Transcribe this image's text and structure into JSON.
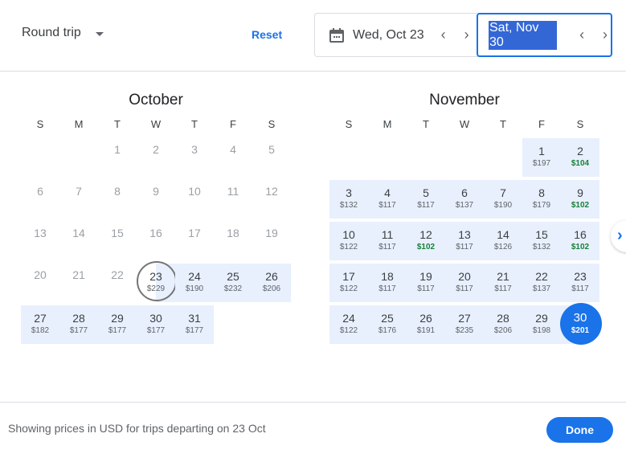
{
  "header": {
    "trip_type": "Round trip",
    "reset_label": "Reset",
    "departure_date": "Wed, Oct 23",
    "return_date": "Sat, Nov 30",
    "prev_glyph": "‹",
    "next_glyph": "›",
    "calendar_icon": "calendar-icon"
  },
  "weekdays": [
    "S",
    "M",
    "T",
    "W",
    "T",
    "F",
    "S"
  ],
  "months": [
    {
      "title": "October",
      "leading_blanks": 2,
      "days": [
        {
          "d": "1",
          "state": "past"
        },
        {
          "d": "2",
          "state": "past"
        },
        {
          "d": "3",
          "state": "past"
        },
        {
          "d": "4",
          "state": "past"
        },
        {
          "d": "5",
          "state": "past"
        },
        {
          "d": "6",
          "state": "past"
        },
        {
          "d": "7",
          "state": "past"
        },
        {
          "d": "8",
          "state": "past"
        },
        {
          "d": "9",
          "state": "past"
        },
        {
          "d": "10",
          "state": "past"
        },
        {
          "d": "11",
          "state": "past"
        },
        {
          "d": "12",
          "state": "past"
        },
        {
          "d": "13",
          "state": "past"
        },
        {
          "d": "14",
          "state": "past"
        },
        {
          "d": "15",
          "state": "past"
        },
        {
          "d": "16",
          "state": "past"
        },
        {
          "d": "17",
          "state": "past"
        },
        {
          "d": "18",
          "state": "past"
        },
        {
          "d": "19",
          "state": "past"
        },
        {
          "d": "20",
          "state": "past"
        },
        {
          "d": "21",
          "state": "past"
        },
        {
          "d": "22",
          "state": "past"
        },
        {
          "d": "23",
          "price": "$229",
          "state": "start"
        },
        {
          "d": "24",
          "price": "$190",
          "state": "inrange"
        },
        {
          "d": "25",
          "price": "$232",
          "state": "inrange"
        },
        {
          "d": "26",
          "price": "$206",
          "state": "inrange"
        },
        {
          "d": "27",
          "price": "$182",
          "state": "inrange"
        },
        {
          "d": "28",
          "price": "$177",
          "state": "inrange"
        },
        {
          "d": "29",
          "price": "$177",
          "state": "inrange"
        },
        {
          "d": "30",
          "price": "$177",
          "state": "inrange"
        },
        {
          "d": "31",
          "price": "$177",
          "state": "inrange"
        }
      ]
    },
    {
      "title": "November",
      "leading_blanks": 5,
      "days": [
        {
          "d": "1",
          "price": "$197",
          "state": "inrange"
        },
        {
          "d": "2",
          "price": "$104",
          "state": "inrange",
          "cheap": true
        },
        {
          "d": "3",
          "price": "$132",
          "state": "inrange"
        },
        {
          "d": "4",
          "price": "$117",
          "state": "inrange"
        },
        {
          "d": "5",
          "price": "$117",
          "state": "inrange"
        },
        {
          "d": "6",
          "price": "$137",
          "state": "inrange"
        },
        {
          "d": "7",
          "price": "$190",
          "state": "inrange"
        },
        {
          "d": "8",
          "price": "$179",
          "state": "inrange"
        },
        {
          "d": "9",
          "price": "$102",
          "state": "inrange",
          "cheap": true
        },
        {
          "d": "10",
          "price": "$122",
          "state": "inrange"
        },
        {
          "d": "11",
          "price": "$117",
          "state": "inrange"
        },
        {
          "d": "12",
          "price": "$102",
          "state": "inrange",
          "cheap": true
        },
        {
          "d": "13",
          "price": "$117",
          "state": "inrange"
        },
        {
          "d": "14",
          "price": "$126",
          "state": "inrange"
        },
        {
          "d": "15",
          "price": "$132",
          "state": "inrange"
        },
        {
          "d": "16",
          "price": "$102",
          "state": "inrange",
          "cheap": true
        },
        {
          "d": "17",
          "price": "$122",
          "state": "inrange"
        },
        {
          "d": "18",
          "price": "$117",
          "state": "inrange"
        },
        {
          "d": "19",
          "price": "$117",
          "state": "inrange"
        },
        {
          "d": "20",
          "price": "$117",
          "state": "inrange"
        },
        {
          "d": "21",
          "price": "$117",
          "state": "inrange"
        },
        {
          "d": "22",
          "price": "$137",
          "state": "inrange"
        },
        {
          "d": "23",
          "price": "$117",
          "state": "inrange"
        },
        {
          "d": "24",
          "price": "$122",
          "state": "inrange"
        },
        {
          "d": "25",
          "price": "$176",
          "state": "inrange"
        },
        {
          "d": "26",
          "price": "$191",
          "state": "inrange"
        },
        {
          "d": "27",
          "price": "$235",
          "state": "inrange"
        },
        {
          "d": "28",
          "price": "$206",
          "state": "inrange"
        },
        {
          "d": "29",
          "price": "$198",
          "state": "inrange"
        },
        {
          "d": "30",
          "price": "$201",
          "state": "end"
        }
      ]
    }
  ],
  "next_month_glyph": "›",
  "footer": {
    "info": "Showing prices in USD for trips departing on 23 Oct",
    "done_label": "Done"
  },
  "colors": {
    "accent": "#1a73e8",
    "range_bg": "#e8f0fe",
    "cheap_price": "#188038"
  }
}
